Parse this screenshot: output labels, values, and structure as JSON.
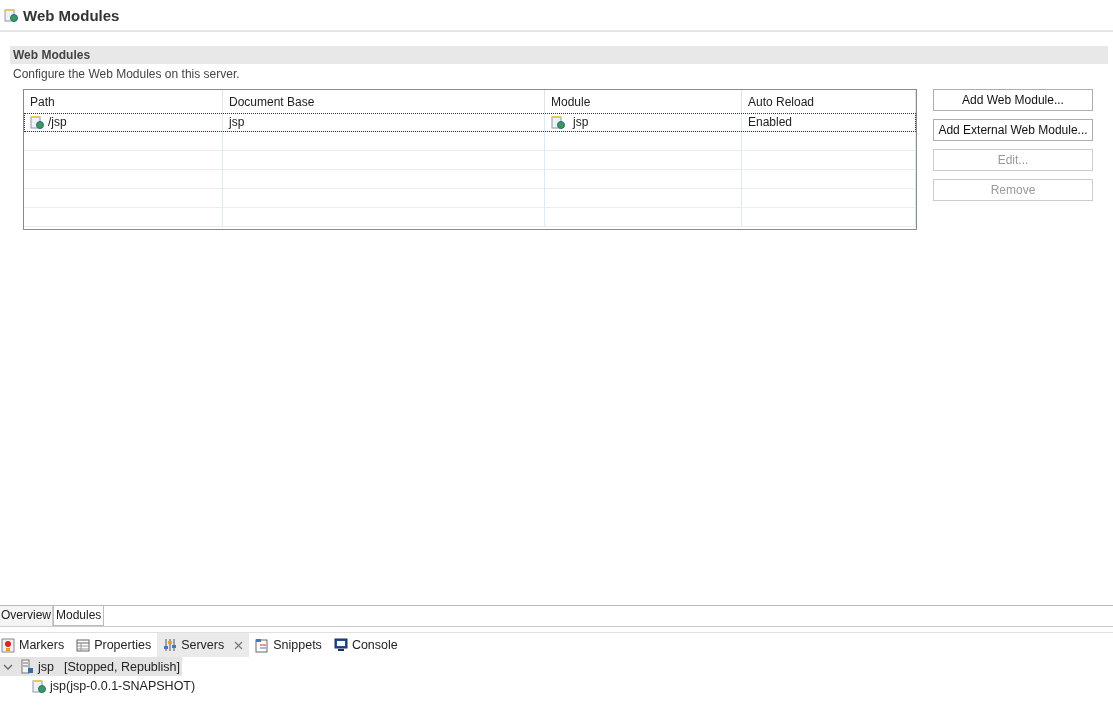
{
  "editor": {
    "title": "Web Modules"
  },
  "section": {
    "title": "Web Modules",
    "description": "Configure the Web Modules on this server."
  },
  "table": {
    "columns": [
      "Path",
      "Document Base",
      "Module",
      "Auto Reload"
    ],
    "rows": [
      {
        "path": "/jsp",
        "document_base": "jsp",
        "module": "jsp",
        "auto_reload": "Enabled",
        "selected": true
      }
    ]
  },
  "buttons": [
    {
      "label": "Add Web Module...",
      "disabled": false
    },
    {
      "label": "Add External Web Module...",
      "disabled": false
    },
    {
      "label": "Edit...",
      "disabled": true
    },
    {
      "label": "Remove",
      "disabled": true
    }
  ],
  "editor_tabs": [
    {
      "label": "Overview",
      "selected": false
    },
    {
      "label": "Modules",
      "selected": true
    }
  ],
  "view_tabs": [
    {
      "label": "Markers",
      "kind": "markers",
      "selected": false,
      "closable": false
    },
    {
      "label": "Properties",
      "kind": "properties",
      "selected": false,
      "closable": false
    },
    {
      "label": "Servers",
      "kind": "servers",
      "selected": true,
      "closable": true
    },
    {
      "label": "Snippets",
      "kind": "snippets",
      "selected": false,
      "closable": false
    },
    {
      "label": "Console",
      "kind": "console",
      "selected": false,
      "closable": false
    }
  ],
  "servers_tree": [
    {
      "label": "jsp",
      "status": "[Stopped, Republish]",
      "expanded": true,
      "selected": true,
      "children": [
        {
          "label": "jsp(jsp-0.0.1-SNAPSHOT)",
          "selected": false
        }
      ]
    }
  ]
}
